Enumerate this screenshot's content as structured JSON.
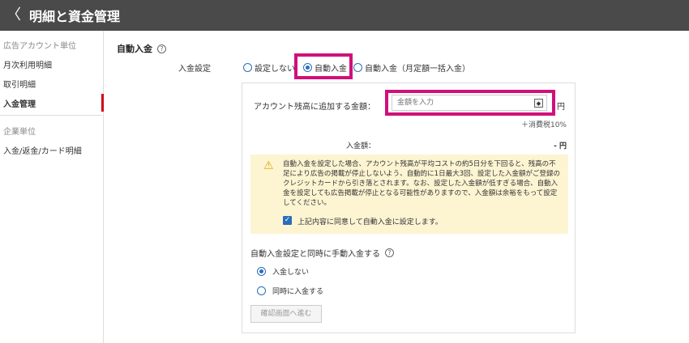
{
  "header": {
    "back_icon": "chevron-left-icon",
    "back": "〈",
    "title": "明細と資金管理"
  },
  "sidebar": {
    "group1": "広告アカウント単位",
    "items": [
      {
        "label": "月次利用明細"
      },
      {
        "label": "取引明細"
      },
      {
        "label": "入金管理"
      }
    ],
    "group2": "企業単位",
    "items2": [
      {
        "label": "入金/返金/カード明細"
      }
    ]
  },
  "main": {
    "title": "自動入金",
    "help": "?",
    "setting_label": "入金設定",
    "options": [
      {
        "label": "設定しない",
        "checked": false
      },
      {
        "label": "自動入金",
        "checked": true
      },
      {
        "label": "自動入金（月定額一括入金）",
        "checked": false
      }
    ],
    "panel": {
      "amount_label": "アカウント残高に追加する金額：",
      "amount_placeholder": "金額を入力",
      "spin": "◆",
      "yen": "円",
      "tax": "＋消費税10%",
      "deposit_label": "入金額：",
      "deposit_value": "- 円",
      "warning_icon": "warning-icon",
      "warning_symbol": "⚠",
      "warning_text": "自動入金を設定した場合、アカウント残高が平均コストの約5日分を下回ると、残高の不足により広告の掲載が停止しないよう、自動的に1日最大3回、設定した入金額がご登録のクレジットカードから引き落とされます。なお、設定した入金額が低すぎる場合、自動入金を設定しても広告掲載が停止となる可能性がありますので、入金額は余裕をもって設定してください。",
      "agree_check": "✓",
      "agree_label": "上記内容に同意して自動入金に設定します。",
      "manual_title": "自動入金設定と同時に手動入金する",
      "manual_options": [
        {
          "label": "入金しない",
          "checked": true
        },
        {
          "label": "同時に入金する",
          "checked": false
        }
      ],
      "confirm_button": "確認画面へ進む"
    }
  },
  "colors": {
    "header_bg": "#4a4a4a",
    "accent_blue": "#2a6ebb",
    "highlight": "#d0107a",
    "active_marker": "#d0021b",
    "warning_bg": "#fdf4d2"
  }
}
